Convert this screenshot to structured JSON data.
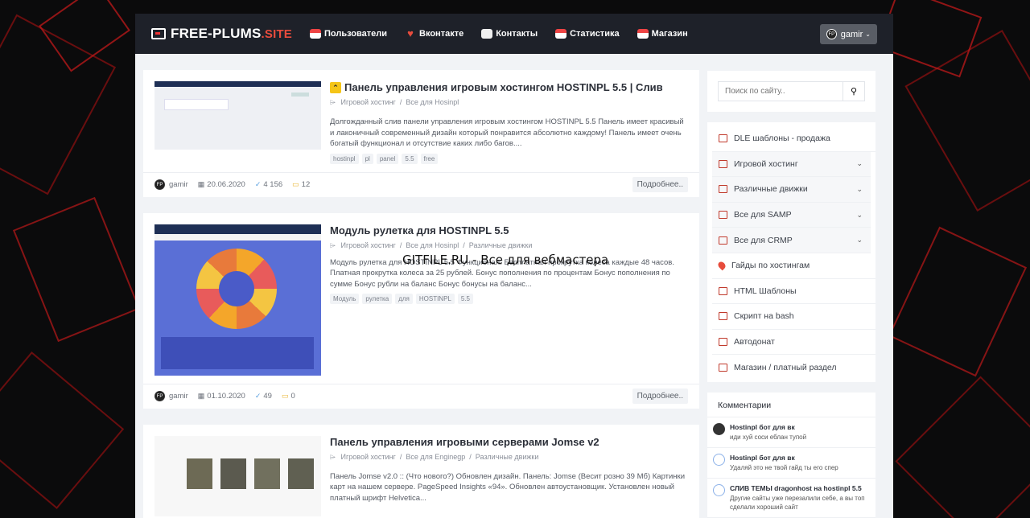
{
  "header": {
    "logo": {
      "main": "FREE-PLUMS",
      "suffix": ".SITE"
    },
    "nav": [
      {
        "label": "Пользователи",
        "icon": "users-icon"
      },
      {
        "label": "Вконтакте",
        "icon": "vk-icon"
      },
      {
        "label": "Контакты",
        "icon": "cloud-icon"
      },
      {
        "label": "Статистика",
        "icon": "cloud-stats-icon"
      },
      {
        "label": "Магазин",
        "icon": "shop-icon"
      }
    ],
    "user": {
      "name": "gamir",
      "avatar_text": "FP"
    }
  },
  "watermark": "GITFILE.RU - Все для вебмастера",
  "posts": [
    {
      "title": "Панель управления игровым хостингом HOSTINPL 5.5 | Слив",
      "pinned": true,
      "categories": [
        "Игровой хостинг",
        "Все для Hosinpl"
      ],
      "description": "Долгожданный слив панели управления игровым хостингом HOSTINPL 5.5 Панель имеет красивый и лаконичный современный дизайн который понравится абсолютно каждому! Панель имеет очень богатый функционал и отсутствие каких либо багов....",
      "tags": [
        "hostinpl",
        "pl",
        "panel",
        "5.5",
        "free"
      ],
      "author": "gamir",
      "date": "20.06.2020",
      "views": "4 156",
      "comments": "12",
      "more": "Подробнее.."
    },
    {
      "title": "Модуль рулетка для HOSTINPL 5.5",
      "pinned": false,
      "categories": [
        "Игровой хостинг",
        "Все для Hosinpl",
        "Различные движки"
      ],
      "description": "Модуль рулетка для HOSTINPL 5.5 Функционал: Бесплатная прокрутка колеса каждые 48 часов. Платная прокрутка колеса за 25 рублей. Бонус пополнения по процентам Бонус пополнения по сумме Бонус рубли на баланс Бонус бонусы на баланс...",
      "tags": [
        "Модуль",
        "рулетка",
        "для",
        "HOSTINPL",
        "5.5"
      ],
      "author": "gamir",
      "date": "01.10.2020",
      "views": "49",
      "comments": "0",
      "more": "Подробнее.."
    },
    {
      "title": "Панель управления игровыми серверами Jomse v2",
      "pinned": false,
      "categories": [
        "Игровой хостинг",
        "Все для Enginegp",
        "Различные движки"
      ],
      "description": "Панель Jomse v2.0 :: (Что нового?) Обновлен дизайн. Панель: Jomse (Весит розно 39 Мб) Картинки карт на нашем сервере. PageSpeed Insights «94». Обновлен автоустановщик. Установлен новый платный шрифт Helvetica...",
      "tags": [],
      "author": "",
      "date": "",
      "views": "",
      "comments": "",
      "more": ""
    }
  ],
  "sidebar": {
    "search_placeholder": "Поиск по сайту..",
    "menu": [
      {
        "label": "DLE шаблоны - продажа",
        "expandable": false
      },
      {
        "label": "Игровой хостинг",
        "expandable": true
      },
      {
        "label": "Различные движки",
        "expandable": true
      },
      {
        "label": "Все для SAMP",
        "expandable": true
      },
      {
        "label": "Все для CRMP",
        "expandable": true
      },
      {
        "label": "Гайды по хостингам",
        "expandable": false
      },
      {
        "label": "HTML Шаблоны",
        "expandable": false
      },
      {
        "label": "Скрипт на bash",
        "expandable": false
      },
      {
        "label": "Автодонат",
        "expandable": false
      },
      {
        "label": "Магазин / платный раздел",
        "expandable": false
      }
    ],
    "comments_title": "Комментарии",
    "comments": [
      {
        "title": "Hostinpl бот для вк",
        "text": "иди   хуй соси еблан   тупой"
      },
      {
        "title": "Hostinpl бот для вк",
        "text": "Удаляй это не твой гайд ты его спер"
      },
      {
        "title": "СЛИВ ТЕМЫ dragonhost на hostinpl 5.5",
        "text": "Другие сайты уже перезалили себе, а вы топ сделали хороший сайт"
      }
    ]
  }
}
